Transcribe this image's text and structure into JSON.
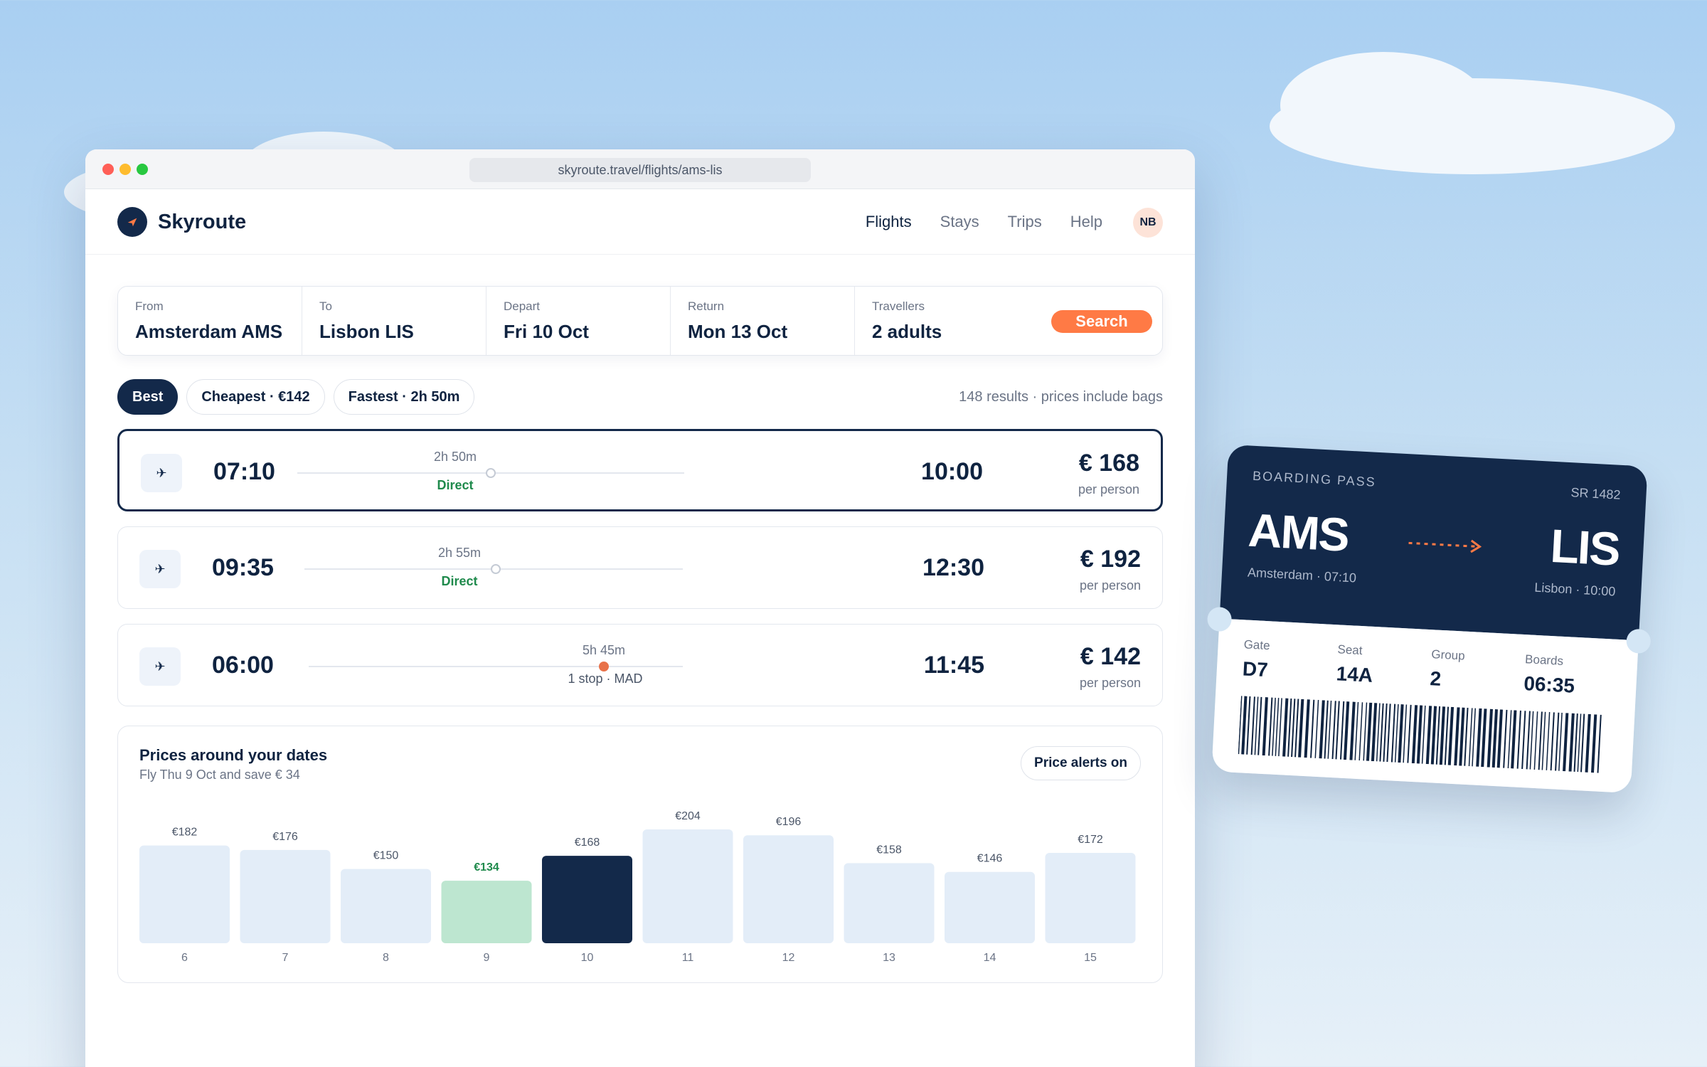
{
  "browser": {
    "url": "skyroute.travel/flights/ams-lis"
  },
  "brand": {
    "name": "Skyroute"
  },
  "nav": {
    "links": [
      "Flights",
      "Stays",
      "Trips",
      "Help"
    ],
    "avatar": "NB"
  },
  "search": {
    "fields": [
      {
        "label": "From",
        "value": "Amsterdam AMS"
      },
      {
        "label": "To",
        "value": "Lisbon LIS"
      },
      {
        "label": "Depart",
        "value": "Fri 10 Oct"
      },
      {
        "label": "Return",
        "value": "Mon 13 Oct"
      },
      {
        "label": "Travellers",
        "value": "2 adults"
      }
    ],
    "button": "Search"
  },
  "filters": {
    "chips": [
      "Best",
      "Cheapest · €142",
      "Fastest · 2h 50m"
    ],
    "active": "Best",
    "meta": "148 results · prices include bags"
  },
  "flights": [
    {
      "depart": "07:10",
      "arrive": "10:00",
      "duration": "2h 50m",
      "stops": "Direct",
      "price": "€ 168",
      "per": "per person",
      "selected": true
    },
    {
      "depart": "09:35",
      "arrive": "12:30",
      "duration": "2h 55m",
      "stops": "Direct",
      "price": "€ 192",
      "per": "per person",
      "selected": false
    },
    {
      "depart": "06:00",
      "arrive": "11:45",
      "duration": "5h 45m",
      "stops": "1 stop · MAD",
      "price": "€ 142",
      "per": "per person",
      "selected": false
    }
  ],
  "prices": {
    "title": "Prices around your dates",
    "subtitle": "Fly Thu 9 Oct and save € 34",
    "alerts_button": "Price alerts on"
  },
  "chart_data": {
    "type": "bar",
    "categories": [
      "6",
      "7",
      "8",
      "9",
      "10",
      "11",
      "12",
      "13",
      "14",
      "15"
    ],
    "values": [
      182,
      176,
      150,
      134,
      168,
      204,
      196,
      158,
      146,
      172
    ],
    "value_labels": [
      "€182",
      "€176",
      "€150",
      "€134",
      "€168",
      "€204",
      "€196",
      "€158",
      "€146",
      "€172"
    ],
    "highlight_cheapest": "9",
    "highlight_selected": "10",
    "colors": {
      "default": "#e3edf8",
      "cheapest": "#bde6d0",
      "selected": "#13294a",
      "cheapest_label": "#1f8a4c"
    }
  },
  "boarding_pass": {
    "label": "BOARDING PASS",
    "flight": "SR 1482",
    "from_code": "AMS",
    "from_sub": "Amsterdam · 07:10",
    "to_code": "LIS",
    "to_sub": "Lisbon · 10:00",
    "details": [
      {
        "label": "Gate",
        "value": "D7"
      },
      {
        "label": "Seat",
        "value": "14A"
      },
      {
        "label": "Group",
        "value": "2"
      },
      {
        "label": "Boards",
        "value": "06:35"
      }
    ]
  },
  "colors": {
    "navy": "#13294a",
    "accent": "#ff7a45",
    "direct": "#1f8a4c",
    "stop": "#e8724a"
  }
}
